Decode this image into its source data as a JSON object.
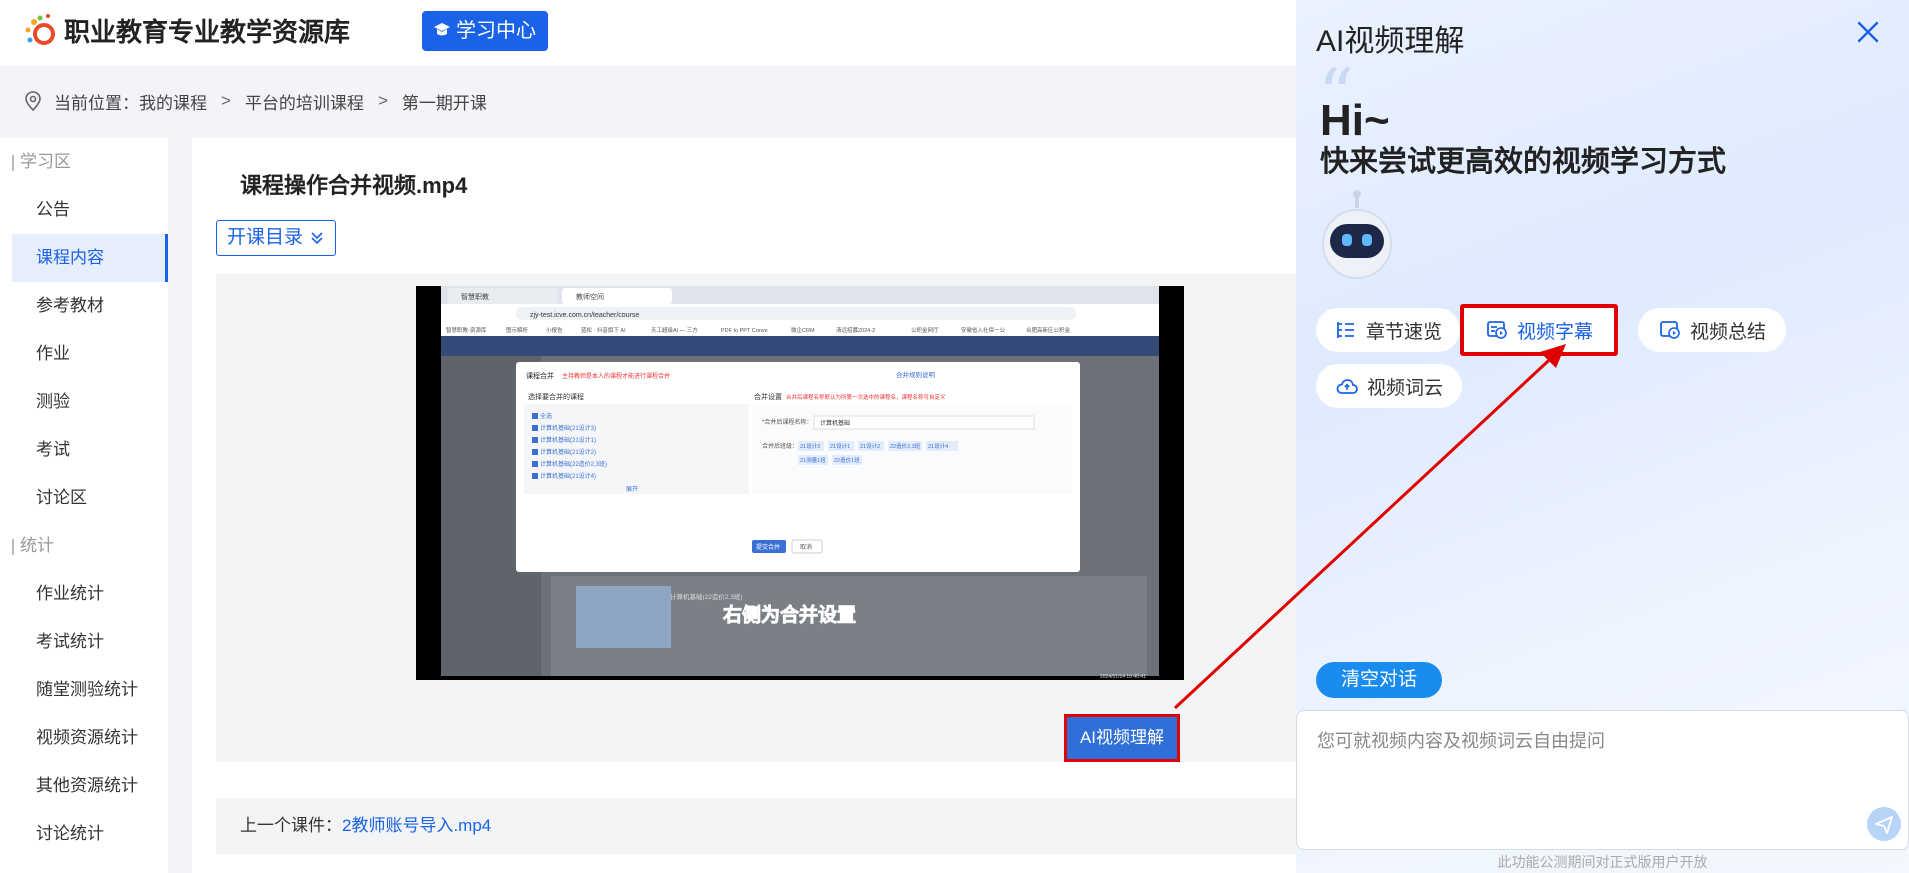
{
  "header": {
    "site_title": "职业教育专业教学资源库",
    "learn_center_label": "学习中心"
  },
  "breadcrumb": {
    "prefix": "当前位置：",
    "items": [
      "我的课程",
      "平台的培训课程",
      "第一期开课"
    ]
  },
  "sidebar": {
    "groups": [
      {
        "label": "学习区",
        "items": [
          "公告",
          "课程内容",
          "参考教材",
          "作业",
          "测验",
          "考试",
          "讨论区"
        ]
      },
      {
        "label": "统计",
        "items": [
          "作业统计",
          "考试统计",
          "随堂测验统计",
          "视频资源统计",
          "其他资源统计",
          "讨论统计"
        ]
      }
    ],
    "active_item": "课程内容"
  },
  "main": {
    "video_title": "课程操作合并视频.mp4",
    "catalog_label": "开课目录",
    "ai_button_label": "AI视频理解",
    "prev_label": "上一个课件：",
    "prev_link": "2教师账号导入.mp4"
  },
  "video": {
    "browser_tabs": [
      "智慧职教",
      "教师空间"
    ],
    "url": "zjy-test.icve.com.cn/teacher/course",
    "bookmarks": [
      "智慧职教-资源库",
      "图示解析",
      "小报告",
      "蓝松 · 抖音旗下 AI",
      "天工超级AI — 三方",
      "PDF to PPT Conve",
      "微企CRM",
      "清远招募2024-2",
      "公积金网厅",
      "安徽省入社保一公",
      "合肥高新区公积金"
    ],
    "dialog_title": "课程合并",
    "dialog_warning": "主持教师是本人的课程才能进行课程合并",
    "dialog_help": "合并规则说明",
    "left_title": "选择要合并的课程",
    "courses": [
      "全选",
      "计算机基础(21设计3)",
      "计算机基础(21设计1)",
      "计算机基础(21设计2)",
      "计算机基础(22造价2,3班)",
      "计算机基础(21设计4)"
    ],
    "expand_label": "展开",
    "right_title": "合并设置",
    "right_note": "合并后课程名称默认为所第一次选中的课程名，课程名称可自定义",
    "name_label": "*合并后课程名称：",
    "name_value": "计算机基础",
    "class_label": "合并后班级：",
    "classes": [
      "21设计3",
      "21设计1",
      "21设计2",
      "22造价2,3班",
      "21设计4",
      "21测量1班",
      "22造价1班"
    ],
    "submit_label": "提交合并",
    "cancel_label": "取消",
    "subtitle": "右侧为合并设置",
    "bg_course_title": "计算机基础(22造价2,3班)",
    "timestamp": "2024/01/14 10:40:41"
  },
  "ai_panel": {
    "title": "AI视频理解",
    "greeting": "Hi~",
    "subtitle": "快来尝试更高效的视频学习方式",
    "chips": [
      {
        "label": "章节速览",
        "icon": "list-icon"
      },
      {
        "label": "视频字幕",
        "icon": "video-doc-icon"
      },
      {
        "label": "视频总结",
        "icon": "video-summary-icon"
      },
      {
        "label": "视频词云",
        "icon": "cloud-icon"
      }
    ],
    "clear_label": "清空对话",
    "input_placeholder": "您可就视频内容及视频词云自由提问",
    "notice": "此功能公测期间对正式版用户开放"
  },
  "colors": {
    "primary": "#1a63e8",
    "highlight": "#e00000"
  }
}
